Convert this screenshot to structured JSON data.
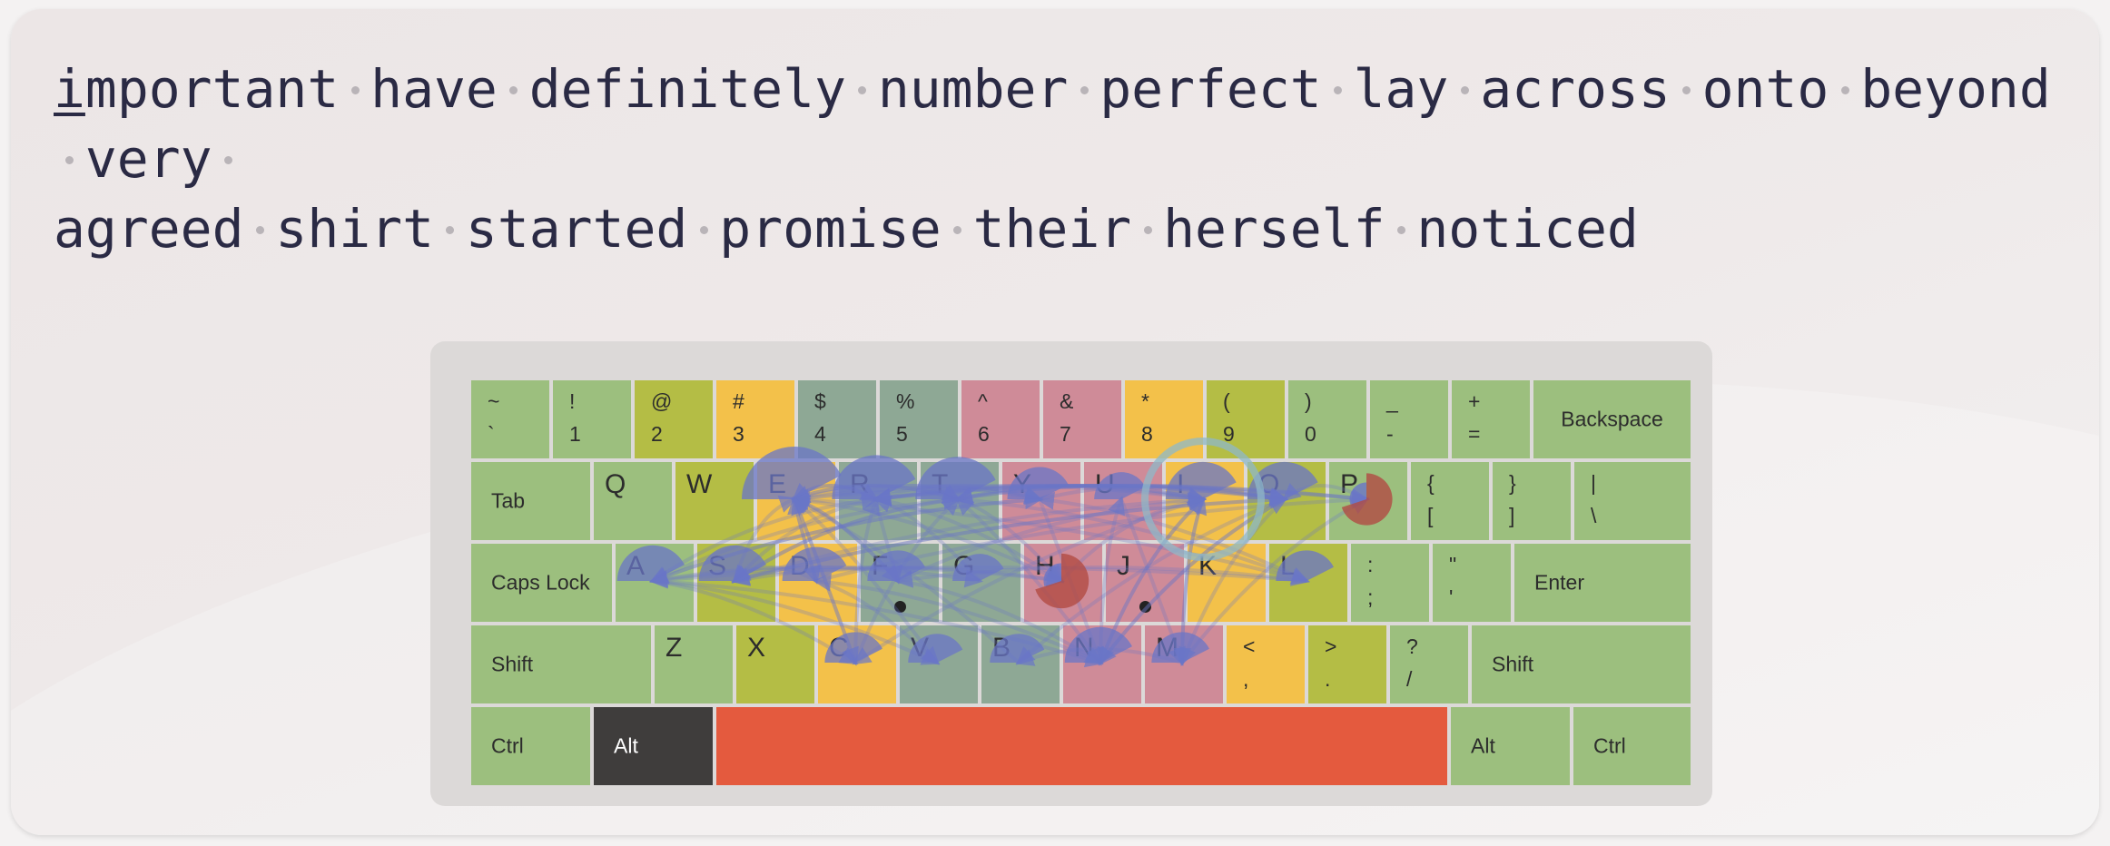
{
  "typing_text": {
    "lines": [
      [
        "important",
        "have",
        "definitely",
        "number",
        "perfect",
        "lay",
        "across",
        "onto",
        "beyond",
        "very"
      ],
      [
        "agreed",
        "shirt",
        "started",
        "promise",
        "their",
        "herself",
        "noticed"
      ]
    ],
    "cursor_index": 0
  },
  "colors": {
    "green": "#9cbf7e",
    "olive": "#b4bd45",
    "yellow": "#f3c14a",
    "teal": "#8ea895",
    "pink": "#cf8b98",
    "space": "#e45a3e",
    "dark": "#3f3d3c",
    "overlay_blue": "#6a76c7",
    "overlay_red": "#b24b44"
  },
  "keyboard": {
    "rows": [
      [
        {
          "top": "~",
          "bottom": "`",
          "name": "key-backtick",
          "color": "green"
        },
        {
          "top": "!",
          "bottom": "1",
          "name": "key-1",
          "color": "green"
        },
        {
          "top": "@",
          "bottom": "2",
          "name": "key-2",
          "color": "olive"
        },
        {
          "top": "#",
          "bottom": "3",
          "name": "key-3",
          "color": "yellow"
        },
        {
          "top": "$",
          "bottom": "4",
          "name": "key-4",
          "color": "teal"
        },
        {
          "top": "%",
          "bottom": "5",
          "name": "key-5",
          "color": "teal"
        },
        {
          "top": "^",
          "bottom": "6",
          "name": "key-6",
          "color": "pink"
        },
        {
          "top": "&",
          "bottom": "7",
          "name": "key-7",
          "color": "pink"
        },
        {
          "top": "*",
          "bottom": "8",
          "name": "key-8",
          "color": "yellow"
        },
        {
          "top": "(",
          "bottom": "9",
          "name": "key-9",
          "color": "olive"
        },
        {
          "top": ")",
          "bottom": "0",
          "name": "key-0",
          "color": "green"
        },
        {
          "top": "_",
          "bottom": "-",
          "name": "key-minus",
          "color": "green"
        },
        {
          "top": "+",
          "bottom": "=",
          "name": "key-equals",
          "color": "green"
        },
        {
          "label": "Backspace",
          "name": "key-backspace",
          "color": "green",
          "center": true
        }
      ],
      [
        {
          "label": "Tab",
          "name": "key-tab",
          "color": "green"
        },
        {
          "big": "Q",
          "name": "key-q",
          "color": "green"
        },
        {
          "big": "W",
          "name": "key-w",
          "color": "olive"
        },
        {
          "big": "E",
          "name": "key-e",
          "color": "yellow"
        },
        {
          "big": "R",
          "name": "key-r",
          "color": "teal"
        },
        {
          "big": "T",
          "name": "key-t",
          "color": "teal"
        },
        {
          "big": "Y",
          "name": "key-y",
          "color": "pink"
        },
        {
          "big": "U",
          "name": "key-u",
          "color": "pink"
        },
        {
          "big": "I",
          "name": "key-i",
          "color": "yellow"
        },
        {
          "big": "O",
          "name": "key-o",
          "color": "olive"
        },
        {
          "big": "P",
          "name": "key-p",
          "color": "green"
        },
        {
          "top": "{",
          "bottom": "[",
          "name": "key-left-bracket",
          "color": "green"
        },
        {
          "top": "}",
          "bottom": "]",
          "name": "key-right-bracket",
          "color": "green"
        },
        {
          "top": "|",
          "bottom": "\\",
          "name": "key-backslash",
          "color": "green"
        }
      ],
      [
        {
          "label": "Caps Lock",
          "name": "key-caps-lock",
          "color": "green"
        },
        {
          "big": "A",
          "name": "key-a",
          "color": "green"
        },
        {
          "big": "S",
          "name": "key-s",
          "color": "olive"
        },
        {
          "big": "D",
          "name": "key-d",
          "color": "yellow"
        },
        {
          "big": "F",
          "name": "key-f",
          "color": "teal",
          "home": true
        },
        {
          "big": "G",
          "name": "key-g",
          "color": "teal"
        },
        {
          "big": "H",
          "name": "key-h",
          "color": "pink"
        },
        {
          "big": "J",
          "name": "key-j",
          "color": "pink",
          "home": true
        },
        {
          "big": "K",
          "name": "key-k",
          "color": "yellow"
        },
        {
          "big": "L",
          "name": "key-l",
          "color": "olive"
        },
        {
          "top": ":",
          "bottom": ";",
          "name": "key-semicolon",
          "color": "green"
        },
        {
          "top": "\"",
          "bottom": "'",
          "name": "key-quote",
          "color": "green"
        },
        {
          "label": "Enter",
          "name": "key-enter",
          "color": "green"
        }
      ],
      [
        {
          "label": "Shift",
          "name": "key-shift-left",
          "color": "green"
        },
        {
          "big": "Z",
          "name": "key-z",
          "color": "green"
        },
        {
          "big": "X",
          "name": "key-x",
          "color": "olive"
        },
        {
          "big": "C",
          "name": "key-c",
          "color": "yellow"
        },
        {
          "big": "V",
          "name": "key-v",
          "color": "teal"
        },
        {
          "big": "B",
          "name": "key-b",
          "color": "teal"
        },
        {
          "big": "N",
          "name": "key-n",
          "color": "pink"
        },
        {
          "big": "M",
          "name": "key-m",
          "color": "pink"
        },
        {
          "top": "<",
          "bottom": ",",
          "name": "key-comma",
          "color": "yellow"
        },
        {
          "top": ">",
          "bottom": ".",
          "name": "key-period",
          "color": "olive"
        },
        {
          "top": "?",
          "bottom": "/",
          "name": "key-slash",
          "color": "green"
        },
        {
          "label": "Shift",
          "name": "key-shift-right",
          "color": "green"
        }
      ],
      [
        {
          "label": "Ctrl",
          "name": "key-ctrl-left",
          "color": "green"
        },
        {
          "label": "Alt",
          "name": "key-alt-left",
          "color": "dark"
        },
        {
          "label": "",
          "name": "key-space",
          "color": "space"
        },
        {
          "label": "Alt",
          "name": "key-alt-right",
          "color": "green"
        },
        {
          "label": "Ctrl",
          "name": "key-ctrl-right",
          "color": "green"
        }
      ]
    ]
  }
}
